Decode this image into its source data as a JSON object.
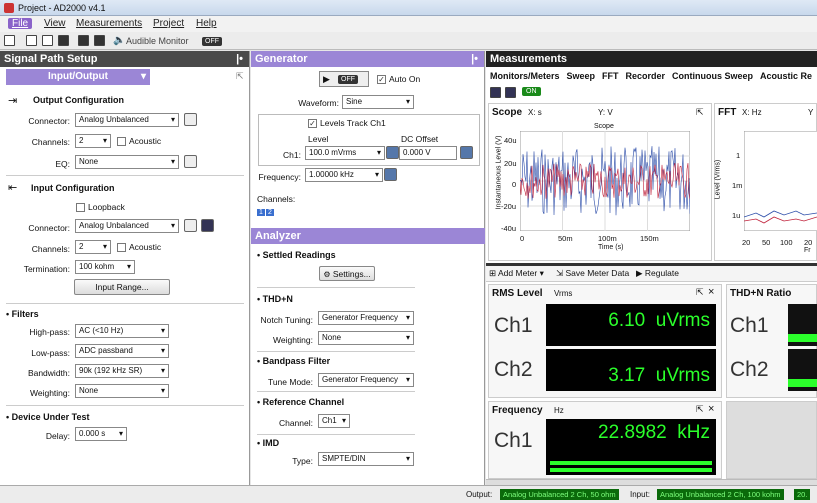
{
  "window": {
    "title": "Project - AD2000 v4.1"
  },
  "menu": [
    "File",
    "View",
    "Measurements",
    "Project",
    "Help"
  ],
  "toolbar": {
    "monitor_label": "Audible Monitor",
    "monitor_state": "OFF"
  },
  "left": {
    "title": "Signal Path Setup",
    "dropdown": "Input/Output",
    "output_config": {
      "title": "Output Configuration",
      "connector_label": "Connector:",
      "connector": "Analog Unbalanced",
      "channels_label": "Channels:",
      "channels": "2",
      "acoustic": "Acoustic",
      "eq_label": "EQ:",
      "eq": "None"
    },
    "input_config": {
      "title": "Input Configuration",
      "loopback": "Loopback",
      "connector_label": "Connector:",
      "connector": "Analog Unbalanced",
      "channels_label": "Channels:",
      "channels": "2",
      "acoustic": "Acoustic",
      "termination_label": "Termination:",
      "termination": "100 kohm",
      "input_range": "Input Range..."
    },
    "filters": {
      "title": "Filters",
      "highpass_label": "High-pass:",
      "highpass": "AC (<10 Hz)",
      "lowpass_label": "Low-pass:",
      "lowpass": "ADC passband",
      "bandwidth_label": "Bandwidth:",
      "bandwidth": "90k (192 kHz SR)",
      "weighting_label": "Weighting:",
      "weighting": "None"
    },
    "dut": {
      "title": "Device Under Test",
      "delay_label": "Delay:",
      "delay": "0.000 s"
    }
  },
  "generator": {
    "title": "Generator",
    "switch": "OFF",
    "autoon": "Auto On",
    "waveform_label": "Waveform:",
    "waveform": "Sine",
    "levels_track": "Levels Track Ch1",
    "level_col": "Level",
    "dc_col": "DC Offset",
    "ch1_label": "Ch1:",
    "ch1_level": "100.0 mVrms",
    "ch1_dc": "0.000 V",
    "frequency_label": "Frequency:",
    "frequency": "1.00000 kHz",
    "channels_label": "Channels:",
    "ch_a": "1",
    "ch_b": "2"
  },
  "analyzer": {
    "title": "Analyzer",
    "settled": "Settled Readings",
    "settings_btn": "Settings...",
    "thdn": "THD+N",
    "notch_label": "Notch Tuning:",
    "notch": "Generator Frequency",
    "weighting_label": "Weighting:",
    "weighting": "None",
    "bandpass": "Bandpass Filter",
    "tune_label": "Tune Mode:",
    "tune": "Generator Frequency",
    "refch": "Reference Channel",
    "channel_label": "Channel:",
    "channel": "Ch1",
    "imd": "IMD",
    "type_label": "Type:",
    "type": "SMPTE/DIN"
  },
  "measurements": {
    "title": "Measurements",
    "tabs": [
      "Monitors/Meters",
      "Sweep",
      "FFT",
      "Recorder",
      "Continuous Sweep",
      "Acoustic Re"
    ],
    "on_label": "ON",
    "scope": {
      "title": "Scope",
      "x_label": "X:",
      "x_unit": "s",
      "y_label": "Y:",
      "y_unit": "V",
      "plot_title": "Scope",
      "ylabel": "Instantaneous Level (V)",
      "xlabel": "Time (s)",
      "yticks": [
        "40u",
        "20u",
        "0",
        "-20u",
        "-40u"
      ],
      "xticks": [
        "0",
        "50m",
        "100m",
        "150m"
      ]
    },
    "fft": {
      "title": "FFT",
      "x_label": "X:",
      "x_unit": "Hz",
      "y_label": "Y",
      "ylabel": "Level (Vrms)",
      "yticks": [
        "1",
        "1m",
        "1u"
      ],
      "xticks": [
        "20",
        "50",
        "100",
        "20"
      ],
      "x_cut": "Fr"
    },
    "meter_bar": {
      "add": "Add Meter",
      "save": "Save Meter Data",
      "regulate": "Regulate"
    },
    "rms": {
      "title": "RMS Level",
      "unit": "Vrms",
      "ch1": "Ch1",
      "ch1_val": "6.10  uVrms",
      "ch2": "Ch2",
      "ch2_val": "3.17  uVrms"
    },
    "thdn": {
      "title": "THD+N Ratio",
      "ch1": "Ch1",
      "ch2": "Ch2"
    },
    "freq": {
      "title": "Frequency",
      "unit": "Hz",
      "ch1": "Ch1",
      "ch1_val": "22.8982  kHz"
    }
  },
  "status": {
    "output_label": "Output:",
    "output": "Analog Unbalanced 2 Ch, 50 ohm",
    "input_label": "Input:",
    "input": "Analog Unbalanced 2 Ch, 100 kohm",
    "extra": "20."
  }
}
